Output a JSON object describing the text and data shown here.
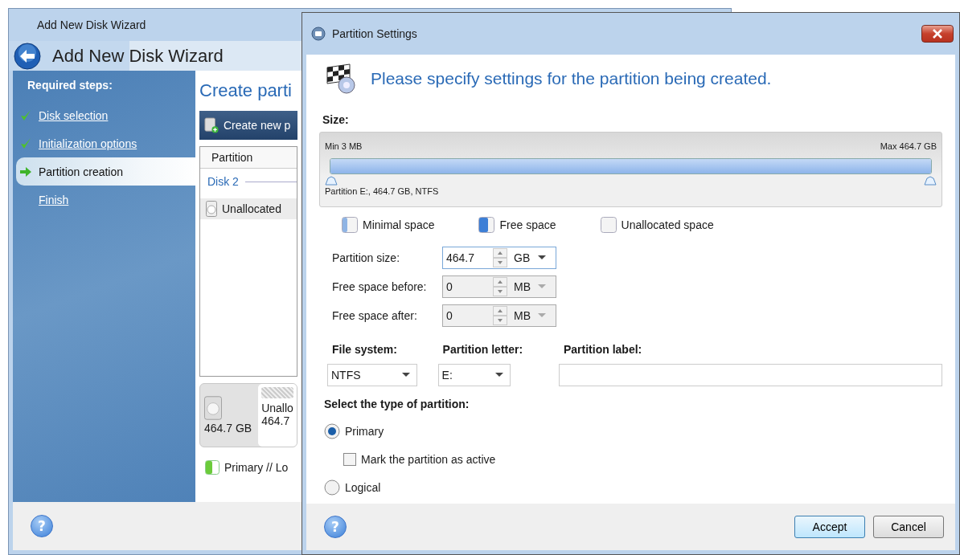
{
  "wizard": {
    "title": "Add New Disk Wizard",
    "heading": "Add New Disk Wizard",
    "steps_title": "Required steps:",
    "steps": [
      {
        "label": "Disk selection",
        "kind": "done",
        "selected": false
      },
      {
        "label": "Initialization options",
        "kind": "done",
        "selected": false
      },
      {
        "label": "Partition creation",
        "kind": "current",
        "selected": true
      },
      {
        "label": "Finish",
        "kind": "todo",
        "selected": false
      }
    ],
    "page_title": "Create parti",
    "toolbar_button": "Create new p",
    "table": {
      "columns": [
        "Partition"
      ],
      "group": "Disk 2",
      "rows": [
        {
          "name": "Unallocated",
          "selected": true
        }
      ]
    },
    "disk_map": {
      "capacity": "464.7 GB",
      "segment_name": "Unallo",
      "segment_size": "464.7"
    },
    "legend": "Primary // Lo",
    "help": "?"
  },
  "dialog": {
    "title": "Partition Settings",
    "heading": "Please specify settings for the partition being created.",
    "size_label": "Size:",
    "slider": {
      "min": "Min 3 MB",
      "max": "Max 464.7 GB",
      "caption": "Partition E:, 464.7 GB, NTFS",
      "level": 1
    },
    "legend": [
      {
        "label": "Minimal space",
        "kind": "minimal"
      },
      {
        "label": "Free space",
        "kind": "free"
      },
      {
        "label": "Unallocated space",
        "kind": "unallocated"
      }
    ],
    "spins": [
      {
        "label": "Partition size:",
        "value": "464.7",
        "unit": "GB",
        "disabled": false
      },
      {
        "label": "Free space before:",
        "value": "0",
        "unit": "MB",
        "disabled": true
      },
      {
        "label": "Free space after:",
        "value": "0",
        "unit": "MB",
        "disabled": true
      }
    ],
    "file_system": {
      "label": "File system:",
      "value": "NTFS"
    },
    "letter": {
      "label": "Partition letter:",
      "value": "E:"
    },
    "partition_label": {
      "label": "Partition label:"
    },
    "type_title": "Select the type of partition:",
    "options": [
      {
        "label": "Primary",
        "kind": "radio",
        "selected": true
      },
      {
        "label": "Mark the partition as active",
        "kind": "checkbox",
        "checked": false
      },
      {
        "label": "Logical",
        "kind": "radio",
        "selected": false
      }
    ],
    "help": "?",
    "buttons": [
      {
        "label": "Accept",
        "default": true
      },
      {
        "label": "Cancel",
        "default": false
      }
    ]
  }
}
